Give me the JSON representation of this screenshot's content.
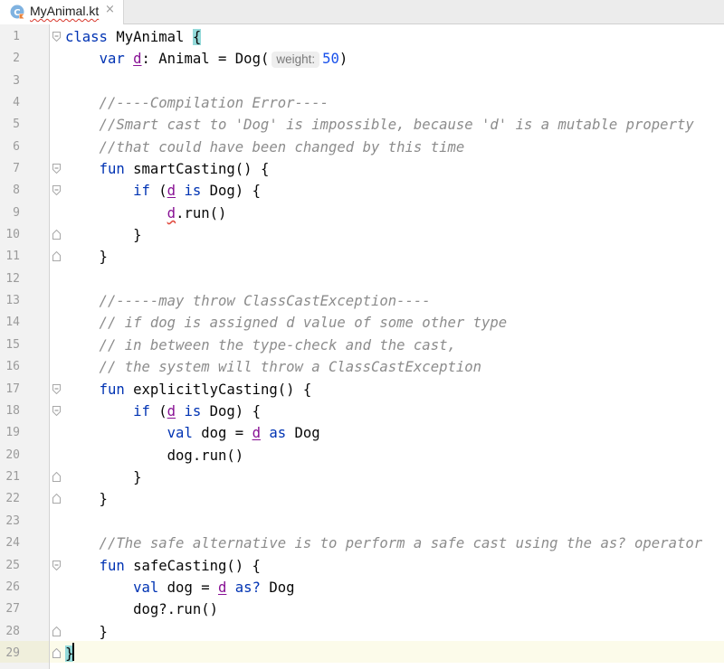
{
  "tab": {
    "label": "MyAnimal.kt",
    "close": "×",
    "icon": "kotlin-class-icon"
  },
  "code": {
    "l1": {
      "num": "1",
      "kw": "class",
      "name": " MyAnimal ",
      "brace": "{"
    },
    "l2": {
      "num": "2",
      "indent": "    ",
      "kw": "var",
      "sp": " ",
      "prop": "d",
      "rest1": ": Animal = Dog(",
      "hint": "weight:",
      "value": "50",
      "close": ")"
    },
    "l3": {
      "num": "3"
    },
    "l4": {
      "num": "4",
      "text": "    //----Compilation Error----"
    },
    "l5": {
      "num": "5",
      "text": "    //Smart cast to 'Dog' is impossible, because 'd' is a mutable property"
    },
    "l6": {
      "num": "6",
      "text": "    //that could have been changed by this time"
    },
    "l7": {
      "num": "7",
      "indent": "    ",
      "kw": "fun",
      "rest": " smartCasting() {"
    },
    "l8": {
      "num": "8",
      "indent": "        ",
      "kw1": "if",
      "open": " (",
      "prop": "d",
      "sp": " ",
      "kw2": "is",
      "rest": " Dog) {"
    },
    "l9": {
      "num": "9",
      "indent": "            ",
      "prop": "d",
      "rest": ".run()"
    },
    "l10": {
      "num": "10",
      "text": "        }"
    },
    "l11": {
      "num": "11",
      "text": "    }"
    },
    "l12": {
      "num": "12"
    },
    "l13": {
      "num": "13",
      "text": "    //-----may throw ClassCastException----"
    },
    "l14": {
      "num": "14",
      "text": "    // if dog is assigned d value of some other type"
    },
    "l15": {
      "num": "15",
      "text": "    // in between the type-check and the cast,"
    },
    "l16": {
      "num": "16",
      "text": "    // the system will throw a ClassCastException"
    },
    "l17": {
      "num": "17",
      "indent": "    ",
      "kw": "fun",
      "rest": " explicitlyCasting() {"
    },
    "l18": {
      "num": "18",
      "indent": "        ",
      "kw1": "if",
      "open": " (",
      "prop": "d",
      "sp": " ",
      "kw2": "is",
      "rest": " Dog) {"
    },
    "l19": {
      "num": "19",
      "indent": "            ",
      "kw1": "val",
      "mid": " dog = ",
      "prop": "d",
      "sp": " ",
      "kw2": "as",
      "rest": " Dog"
    },
    "l20": {
      "num": "20",
      "text": "            dog.run()"
    },
    "l21": {
      "num": "21",
      "text": "        }"
    },
    "l22": {
      "num": "22",
      "text": "    }"
    },
    "l23": {
      "num": "23"
    },
    "l24": {
      "num": "24",
      "text": "    //The safe alternative is to perform a safe cast using the as? operator"
    },
    "l25": {
      "num": "25",
      "indent": "    ",
      "kw": "fun",
      "rest": " safeCasting() {"
    },
    "l26": {
      "num": "26",
      "indent": "        ",
      "kw1": "val",
      "mid": " dog = ",
      "prop": "d",
      "sp": " ",
      "kw2": "as?",
      "rest": " Dog"
    },
    "l27": {
      "num": "27",
      "text": "        dog?.run()"
    },
    "l28": {
      "num": "28",
      "text": "    }"
    },
    "l29": {
      "num": "29",
      "brace": "}"
    }
  },
  "colors": {
    "keyword": "#0033b3",
    "comment": "#8c8c8c",
    "property": "#871094",
    "number": "#1750eb",
    "brace_match": "#93d9d9",
    "caret_row": "#fcfbea"
  }
}
